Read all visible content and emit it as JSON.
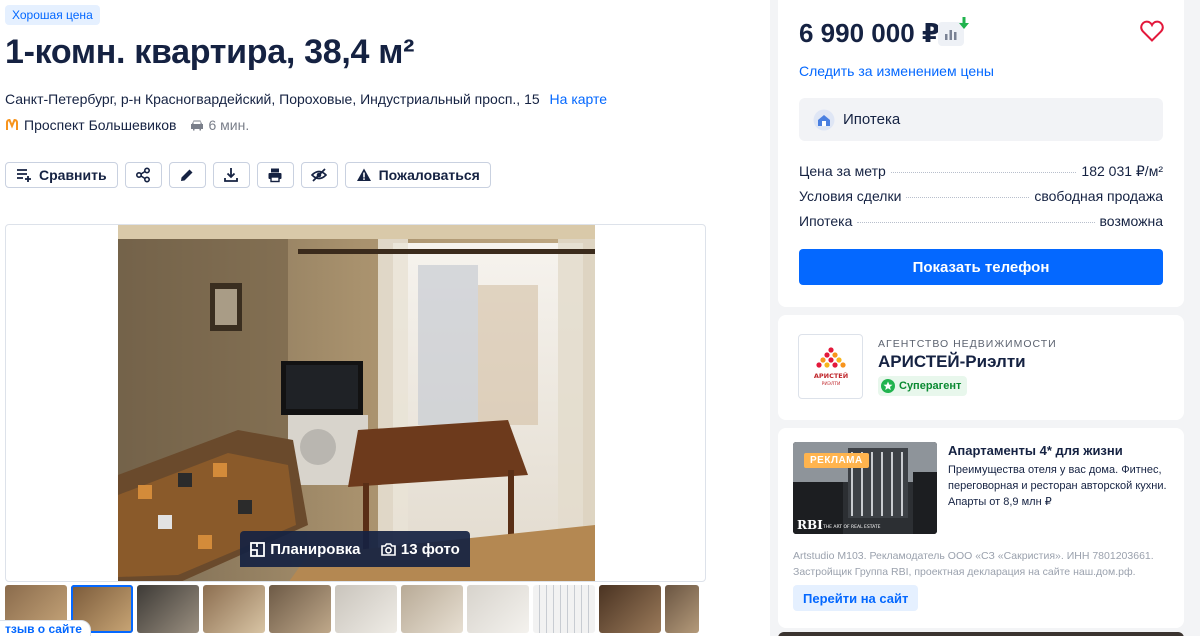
{
  "listing": {
    "badge": "Хорошая цена",
    "title": "1-комн. квартира, 38,4 м²",
    "address": "Санкт-Петербург, р-н Красногвардейский, Пороховые, Индустриальный просп., 15",
    "map_link": "На карте",
    "metro": "Проспект Большевиков",
    "metro_time": "6 мин.",
    "metro_color": "#f7941d"
  },
  "toolbar": {
    "compare_label": "Сравнить",
    "report_label": "Пожаловаться",
    "icons": [
      "compare-icon",
      "share-icon",
      "edit-icon",
      "download-icon",
      "print-icon",
      "hide-icon",
      "warning-icon"
    ]
  },
  "gallery": {
    "plan_label": "Планировка",
    "photos_label": "13 фото",
    "thumb_count": 11,
    "active_thumb": 2
  },
  "feedback_label": "тзыв о сайте",
  "price_card": {
    "price": "6 990 000 ₽",
    "follow_label": "Следить за изменением цены",
    "mortgage_label": "Ипотека",
    "facts": [
      {
        "label": "Цена за метр",
        "value": "182 031 ₽/м²"
      },
      {
        "label": "Условия сделки",
        "value": "свободная продажа"
      },
      {
        "label": "Ипотека",
        "value": "возможна"
      }
    ],
    "phone_button": "Показать телефон",
    "accent_color": "#0468ff"
  },
  "agent": {
    "type_label": "АГЕНТСТВО НЕДВИЖИМОСТИ",
    "name": "АРИСТЕЙ-Риэлти",
    "badge": "Суперагент",
    "logo_text": "АРИСТЕЙ",
    "logo_subtext": "РИЭЛТИ"
  },
  "ad": {
    "label": "РЕКЛАМА",
    "title": "Апартаменты 4* для жизни",
    "text": "Преимущества отеля у вас дома. Фитнес, переговорная и ресторан авторской кухни. Апарты от 8,9 млн ₽",
    "image_brand": "RBI",
    "image_brand_sub": "THE ART OF REAL ESTATE",
    "legal": "Artstudio M103. Рекламодатель ООО «СЗ «Сакристия». ИНН 7801203661. Застройщик Группа RBI, проектная декларация на сайте наш.дом.рф.",
    "button": "Перейти на сайт"
  }
}
